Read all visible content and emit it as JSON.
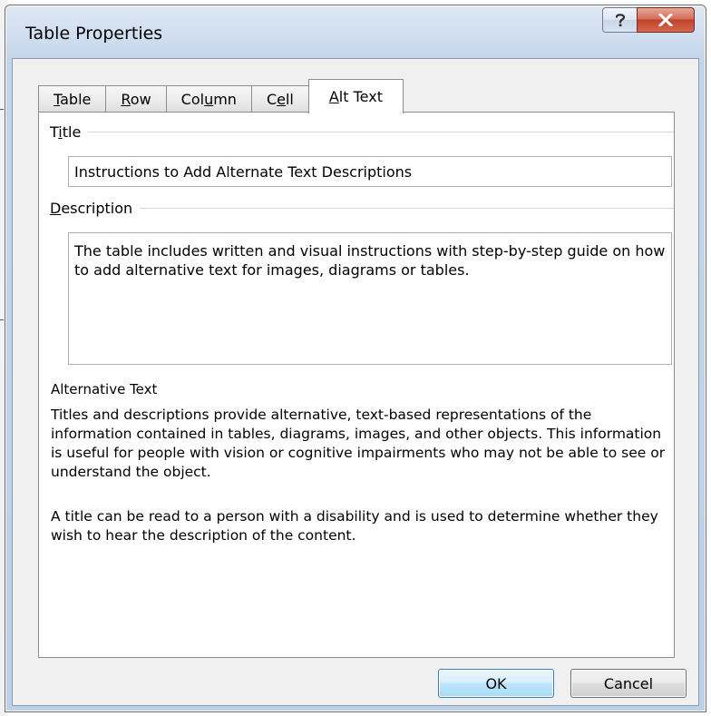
{
  "window": {
    "title": "Table Properties",
    "help_icon": "question-mark",
    "close_icon": "x-mark",
    "accent_close": "#c7432a"
  },
  "tabs": [
    {
      "label_pre": "",
      "label_acc": "T",
      "label_post": "able",
      "active": false
    },
    {
      "label_pre": "",
      "label_acc": "R",
      "label_post": "ow",
      "active": false
    },
    {
      "label_pre": "Col",
      "label_acc": "u",
      "label_post": "mn",
      "active": false
    },
    {
      "label_pre": "C",
      "label_acc": "e",
      "label_post": "ll",
      "active": false
    },
    {
      "label_pre": "",
      "label_acc": "A",
      "label_post": "lt Text",
      "active": true
    }
  ],
  "alt_text": {
    "title_label_pre": "T",
    "title_label_acc": "i",
    "title_label_post": "tle",
    "title_value": "Instructions to Add Alternate Text Descriptions",
    "description_label_acc": "D",
    "description_label_post": "escription",
    "description_value": "The table includes written and visual instructions with step-by-step guide on how to add alternative text for images, diagrams or tables.",
    "help_heading": "Alternative Text",
    "help_paragraph_1": "Titles and descriptions provide alternative, text-based representations of the information contained in tables, diagrams, images, and other objects. This information is useful for people with vision or cognitive impairments who may not be able to see or understand the object.",
    "help_paragraph_2": "A title can be read to a person with a disability and is used to determine whether they wish to hear the description of the content."
  },
  "buttons": {
    "ok_label": "OK",
    "cancel_label": "Cancel"
  }
}
